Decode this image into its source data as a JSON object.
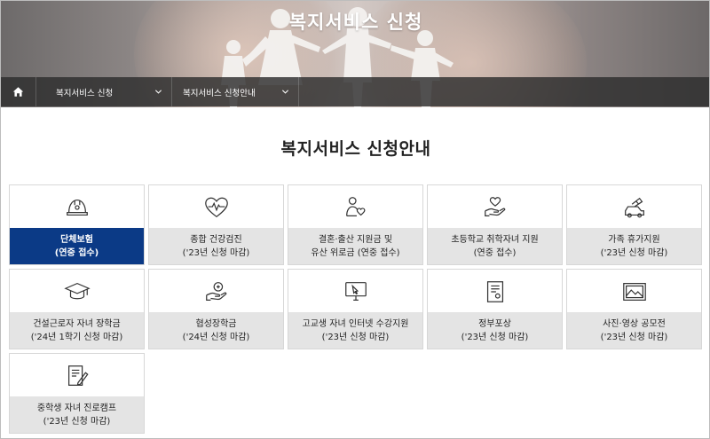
{
  "hero": {
    "title": "복지서비스 신청"
  },
  "breadcrumb": {
    "home_icon": "home-icon",
    "items": [
      {
        "label": "복지서비스 신청"
      },
      {
        "label": "복지서비스 신청안내"
      }
    ]
  },
  "page": {
    "title": "복지서비스 신청안내"
  },
  "colors": {
    "active": "#0b3a86",
    "label_bg": "#e4e4e4"
  },
  "services": [
    {
      "icon": "helmet-icon",
      "line1": "단체보험",
      "line2": "(연중 접수)",
      "active": true
    },
    {
      "icon": "heart-pulse-icon",
      "line1": "종합 건강검진",
      "line2": "('23년 신청 마감)"
    },
    {
      "icon": "wedding-couple-icon",
      "line1": "결혼·출산 지원금 및",
      "line2": "유산 위로금 (연중 접수)"
    },
    {
      "icon": "hand-heart-icon",
      "line1": "초등학교 취학자녀 지원",
      "line2": "(연중 접수)"
    },
    {
      "icon": "family-car-icon",
      "line1": "가족 휴가지원",
      "line2": "('23년 신청 마감)"
    },
    {
      "icon": "graduation-cap-icon",
      "line1": "건설근로자 자녀 장학금",
      "line2": "('24년 1학기 신청 마감)"
    },
    {
      "icon": "hand-coin-icon",
      "line1": "협성장학금",
      "line2": "('24년 신청 마감)"
    },
    {
      "icon": "monitor-icon",
      "line1": "고교생 자녀 인터넷 수강지원",
      "line2": "('23년 신청 마감)"
    },
    {
      "icon": "certificate-icon",
      "line1": "정부포상",
      "line2": "('23년 신청 마감)"
    },
    {
      "icon": "picture-icon",
      "line1": "사진·영상 공모전",
      "line2": "('23년 신청 마감)"
    },
    {
      "icon": "document-pen-icon",
      "line1": "중학생 자녀 진로캠프",
      "line2": "('23년 신청 마감)"
    }
  ]
}
